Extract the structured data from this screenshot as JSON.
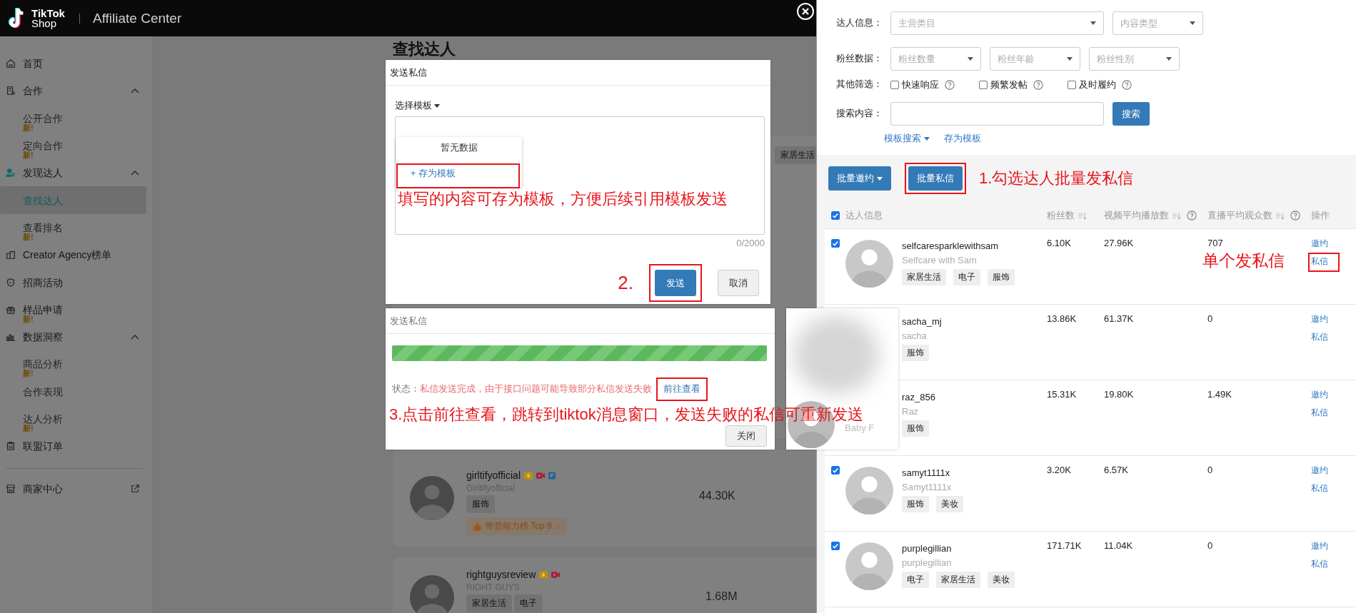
{
  "header": {
    "logo_top": "TikTok",
    "logo_bottom": "Shop",
    "title": "Affiliate Center"
  },
  "sidebar": {
    "items": [
      {
        "label": "首页",
        "selected": false
      },
      {
        "label": "合作",
        "selected": false,
        "expanded": true,
        "children": [
          {
            "label": "公开合作",
            "badge": "新!",
            "selected": false
          },
          {
            "label": "定向合作",
            "badge": "新!",
            "selected": false
          }
        ]
      },
      {
        "label": "发现达人",
        "selected": false,
        "expanded": true,
        "children": [
          {
            "label": "查找达人",
            "selected": true
          },
          {
            "label": "查看排名",
            "badge": "新!",
            "selected": false
          }
        ]
      },
      {
        "label": "Creator Agency榜单",
        "selected": false
      },
      {
        "label": "招商活动",
        "selected": false
      },
      {
        "label": "样品申请",
        "badge": "新!",
        "selected": false
      },
      {
        "label": "数据洞察",
        "selected": false,
        "expanded": true,
        "children": [
          {
            "label": "商品分析",
            "badge": "新!",
            "selected": false
          },
          {
            "label": "合作表现",
            "selected": false
          },
          {
            "label": "达人分析",
            "badge": "新!",
            "selected": false
          }
        ]
      },
      {
        "label": "联盟订单",
        "selected": false
      }
    ],
    "footer_item": {
      "label": "商家中心"
    }
  },
  "background": {
    "page_title": "查找达人",
    "peek_tags": [
      "家居生活"
    ],
    "creators": [
      {
        "username": "girltifyofficial",
        "display_name": "Girltifyofficial",
        "badges": [
          {
            "kind": "lightning"
          },
          {
            "kind": "video"
          },
          {
            "kind": "post"
          }
        ],
        "tags": [
          "服饰"
        ],
        "rank": "带货能力榜 Top 9",
        "followers": "44.30K"
      },
      {
        "username": "rightguysreview",
        "display_name": "RIGHT GUYS",
        "badges": [
          {
            "kind": "lightning"
          },
          {
            "kind": "video"
          }
        ],
        "tags": [
          "家居生活",
          "电子"
        ],
        "followers": "1.68M"
      }
    ]
  },
  "compose_modal": {
    "title": "发送私信",
    "template_label": "选择模板",
    "dropdown": {
      "empty_text": "暂无数据",
      "save_action": "+ 存为模板",
      "save_annotated": true
    },
    "note": "填写的内容可存为模板，方便后续引用模板发送",
    "counter": "0/2000",
    "step": "2.",
    "buttons": [
      {
        "label": "发送",
        "kind": "primary",
        "annotated": true
      },
      {
        "label": "取消",
        "kind": "default",
        "annotated": false
      }
    ]
  },
  "progress_modal": {
    "title": "发送私信",
    "level": 1,
    "status_label": "状态：",
    "status_text": "私信发送完成，由于接口问题可能导致部分私信发送失败",
    "link": "前往查看",
    "link_annotated": true,
    "close": "关闭",
    "note": "3.点击前往查看，跳转到tiktok消息窗口，发送失败的私信可重新发送"
  },
  "snippet": {
    "text": "Baby F"
  },
  "filters": {
    "rows": [
      {
        "label": "达人信息：",
        "kind": "selects",
        "items": [
          {
            "placeholder": "主营类目"
          },
          {
            "placeholder": "内容类型"
          }
        ]
      },
      {
        "label": "粉丝数据：",
        "kind": "selects",
        "items": [
          {
            "placeholder": "粉丝数量"
          },
          {
            "placeholder": "粉丝年龄"
          },
          {
            "placeholder": "粉丝性别"
          }
        ]
      },
      {
        "label": "其他筛选：",
        "kind": "checks",
        "items": [
          {
            "label": "快速响应",
            "checked": false
          },
          {
            "label": "频繁发帖",
            "checked": false
          },
          {
            "label": "及时履约",
            "checked": false
          }
        ]
      },
      {
        "label": "搜索内容：",
        "kind": "search",
        "button": "搜索"
      }
    ],
    "links": [
      {
        "label": "模板搜索",
        "dropdown": true
      },
      {
        "label": "存为模板",
        "dropdown": false
      }
    ]
  },
  "toolbar": {
    "buttons": [
      {
        "label": "批量邀约",
        "dropdown": true,
        "annotated": false
      },
      {
        "label": "批量私信",
        "dropdown": false,
        "annotated": true
      }
    ],
    "note": "1.勾选达人批量发私信"
  },
  "table": {
    "select_all": true,
    "columns": [
      {
        "label": "达人信息",
        "kind": "plain"
      },
      {
        "label": "粉丝数",
        "kind": "sortable"
      },
      {
        "label": "视频平均播放数",
        "kind": "sortable_help"
      },
      {
        "label": "直播平均观众数",
        "kind": "sortable_help"
      },
      {
        "label": "操作",
        "kind": "plain"
      }
    ],
    "rows": [
      {
        "checked": true,
        "username": "selfcaresparklewithsam",
        "display_name": "Selfcare with Sam",
        "tags": [
          "家居生活",
          "电子",
          "服饰"
        ],
        "followers": "6.10K",
        "video_views": "27.96K",
        "live_viewers": "707",
        "actions": [
          {
            "label": "邀约",
            "annotated": false
          },
          {
            "label": "私信",
            "annotated": true
          }
        ],
        "note": "单个发私信"
      },
      {
        "username": "sacha_mj",
        "display_name": "sacha",
        "tags": [
          "服饰"
        ],
        "followers": "13.86K",
        "video_views": "61.37K",
        "live_viewers": "0",
        "actions": [
          {
            "label": "邀约",
            "annotated": false
          },
          {
            "label": "私信",
            "annotated": false
          }
        ]
      },
      {
        "username": "raz_856",
        "display_name": "Raz",
        "tags": [
          "服饰"
        ],
        "followers": "15.31K",
        "video_views": "19.80K",
        "live_viewers": "1.49K",
        "actions": [
          {
            "label": "邀约",
            "annotated": false
          },
          {
            "label": "私信",
            "annotated": false
          }
        ]
      },
      {
        "checked": true,
        "username": "samyt1111x",
        "display_name": "Samyt1111x",
        "tags": [
          "服饰",
          "美妆"
        ],
        "followers": "3.20K",
        "video_views": "6.57K",
        "live_viewers": "0",
        "actions": [
          {
            "label": "邀约",
            "annotated": false
          },
          {
            "label": "私信",
            "annotated": false
          }
        ]
      },
      {
        "checked": true,
        "username": "purplegillian",
        "display_name": "purplegillian",
        "tags": [
          "电子",
          "家居生活",
          "美妆"
        ],
        "followers": "171.71K",
        "video_views": "11.04K",
        "live_viewers": "0",
        "actions": [
          {
            "label": "邀约",
            "annotated": false
          },
          {
            "label": "私信",
            "annotated": false
          }
        ]
      }
    ]
  }
}
